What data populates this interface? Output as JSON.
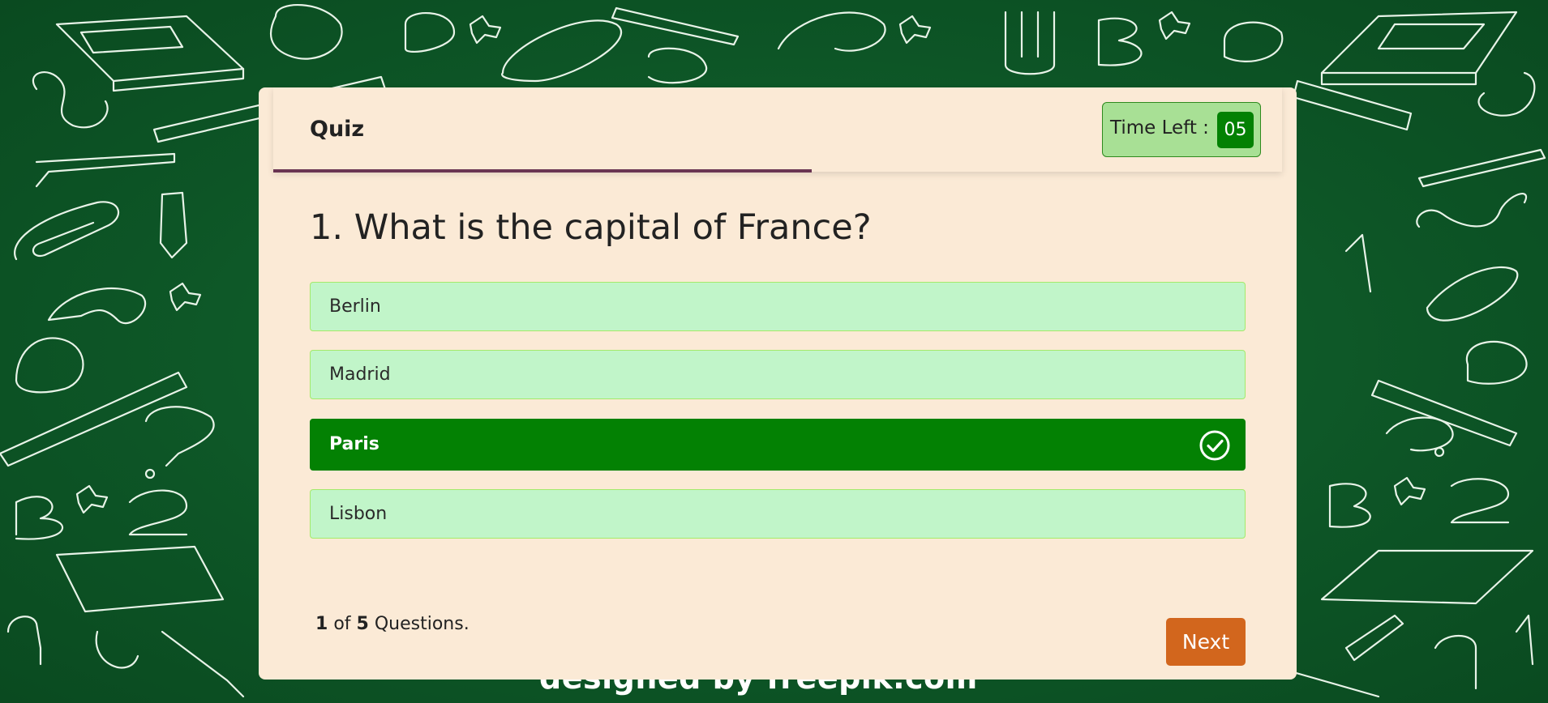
{
  "header": {
    "title": "Quiz",
    "timer_label": "Time Left :",
    "timer_value": "05"
  },
  "question": {
    "text": "1. What is the capital of France?"
  },
  "options": [
    {
      "label": "Berlin"
    },
    {
      "label": "Madrid"
    },
    {
      "label": "Paris"
    },
    {
      "label": "Lisbon"
    }
  ],
  "footer": {
    "current": "1",
    "of": "of",
    "total": "5",
    "questions_label": "Questions.",
    "next_label": "Next"
  },
  "background": {
    "credit": "designed by  freepik.com"
  },
  "colors": {
    "correct": "#038103",
    "option_bg": "#c1f5c9",
    "next_button": "#d2661d",
    "card_bg": "#fbead6",
    "progress": "#6a3452"
  }
}
